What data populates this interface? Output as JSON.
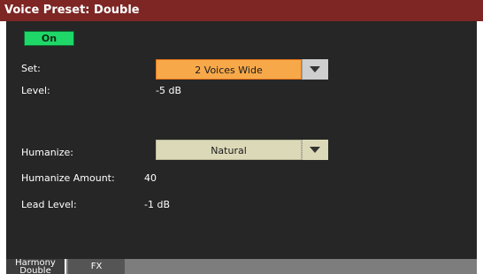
{
  "window": {
    "title": "Voice Preset: Double"
  },
  "on_button": {
    "label": "On"
  },
  "set": {
    "label": "Set:",
    "value": "2 Voices Wide"
  },
  "level": {
    "label": "Level:",
    "value": "-5 dB"
  },
  "humanize": {
    "label": "Humanize:",
    "value": "Natural"
  },
  "humanize_amount": {
    "label": "Humanize Amount:",
    "value": "40"
  },
  "lead_level": {
    "label": "Lead Level:",
    "value": "-1 dB"
  },
  "tabs": [
    {
      "label": "Harmony Double"
    },
    {
      "label": "FX"
    }
  ],
  "colors": {
    "title_bar": "#7d2624",
    "panel_bg": "#262626",
    "on_button": "#1fd768",
    "selected_field": "#f7a94a",
    "dropdown_field": "#dcd9b8"
  }
}
